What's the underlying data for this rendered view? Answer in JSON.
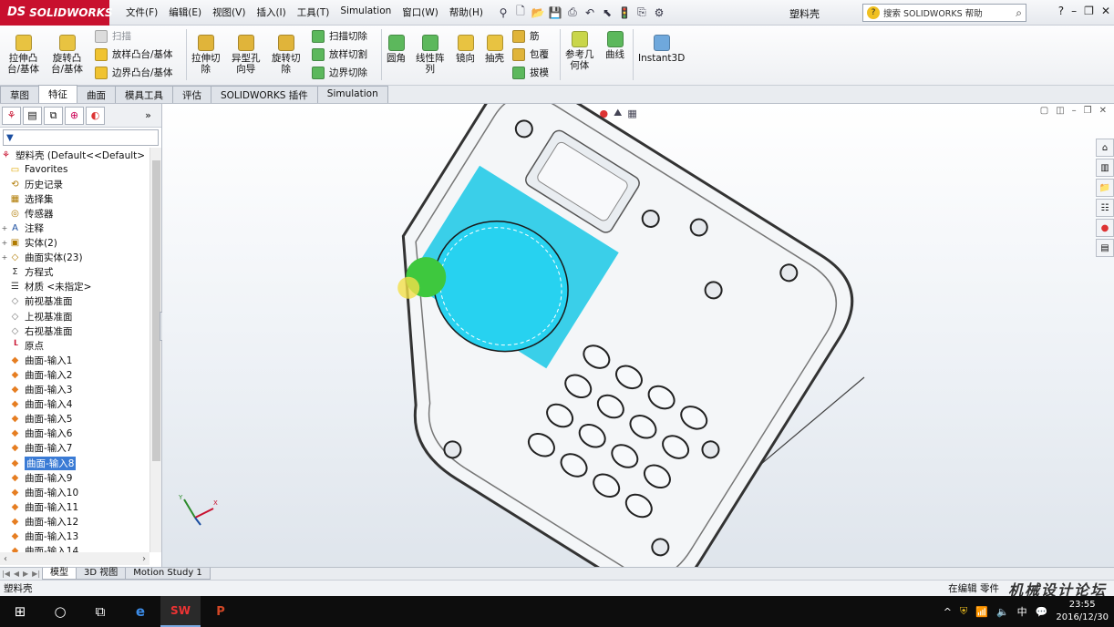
{
  "app": {
    "logo_prefix": "DS",
    "logo_text": "SOLIDWORKS",
    "doc_title": "塑料壳",
    "search_placeholder": "搜索 SOLIDWORKS 帮助"
  },
  "menu": [
    "文件(F)",
    "编辑(E)",
    "视图(V)",
    "插入(I)",
    "工具(T)",
    "Simulation",
    "窗口(W)",
    "帮助(H)"
  ],
  "ribbon": {
    "extrude_boss": "拉伸凸\n台/基体",
    "revolve_boss": "旋转凸\n台/基体",
    "sweep": "扫描",
    "loft": "放样凸台/基体",
    "boundary_boss": "边界凸台/基体",
    "extrude_cut": "拉伸切\n除",
    "hole_wizard": "异型孔\n向导",
    "revolve_cut": "旋转切\n除",
    "swept_cut": "扫描切除",
    "lofted_cut": "放样切割",
    "boundary_cut": "边界切除",
    "fillet": "圆角",
    "linear_pattern": "线性阵\n列",
    "mirror": "镜向",
    "shell": "抽壳",
    "rib": "筋",
    "wrap": "包覆",
    "draft": "拔模",
    "ref_geometry": "参考几\n何体",
    "curves": "曲线",
    "instant3d": "Instant3D"
  },
  "tabs": [
    "草图",
    "特征",
    "曲面",
    "模具工具",
    "评估",
    "SOLIDWORKS 插件",
    "Simulation"
  ],
  "active_tab": "特征",
  "tree": {
    "root": "塑料壳  (Default<<Default>",
    "items": [
      {
        "label": "Favorites",
        "icon": "folder-icon",
        "exp": ""
      },
      {
        "label": "历史记录",
        "icon": "history-icon",
        "exp": ""
      },
      {
        "label": "选择集",
        "icon": "selection-set-icon",
        "exp": ""
      },
      {
        "label": "传感器",
        "icon": "sensor-icon",
        "exp": ""
      },
      {
        "label": "注释",
        "icon": "annotation-icon",
        "exp": "+"
      },
      {
        "label": "实体(2)",
        "icon": "solid-bodies-icon",
        "exp": "+"
      },
      {
        "label": "曲面实体(23)",
        "icon": "surface-bodies-icon",
        "exp": "+"
      },
      {
        "label": "方程式",
        "icon": "equation-icon",
        "exp": ""
      },
      {
        "label": "材质 <未指定>",
        "icon": "material-icon",
        "exp": ""
      },
      {
        "label": "前视基准面",
        "icon": "plane-icon",
        "exp": ""
      },
      {
        "label": "上视基准面",
        "icon": "plane-icon",
        "exp": ""
      },
      {
        "label": "右视基准面",
        "icon": "plane-icon",
        "exp": ""
      },
      {
        "label": "原点",
        "icon": "origin-icon",
        "exp": ""
      },
      {
        "label": "曲面-输入1",
        "icon": "surface-icon",
        "exp": ""
      },
      {
        "label": "曲面-输入2",
        "icon": "surface-icon",
        "exp": ""
      },
      {
        "label": "曲面-输入3",
        "icon": "surface-icon",
        "exp": ""
      },
      {
        "label": "曲面-输入4",
        "icon": "surface-icon",
        "exp": ""
      },
      {
        "label": "曲面-输入5",
        "icon": "surface-icon",
        "exp": ""
      },
      {
        "label": "曲面-输入6",
        "icon": "surface-icon",
        "exp": ""
      },
      {
        "label": "曲面-输入7",
        "icon": "surface-icon",
        "exp": ""
      },
      {
        "label": "曲面-输入8",
        "icon": "surface-icon",
        "exp": "",
        "selected": true
      },
      {
        "label": "曲面-输入9",
        "icon": "surface-icon",
        "exp": ""
      },
      {
        "label": "曲面-输入10",
        "icon": "surface-icon",
        "exp": ""
      },
      {
        "label": "曲面-输入11",
        "icon": "surface-icon",
        "exp": ""
      },
      {
        "label": "曲面-输入12",
        "icon": "surface-icon",
        "exp": ""
      },
      {
        "label": "曲面-输入13",
        "icon": "surface-icon",
        "exp": ""
      },
      {
        "label": "曲面-输入14",
        "icon": "surface-icon",
        "exp": ""
      }
    ]
  },
  "bottom_tabs": [
    "模型",
    "3D 视图",
    "Motion Study 1"
  ],
  "status": {
    "left": "塑料壳",
    "mode": "在编辑 零件",
    "watermark": "机械设计论坛"
  },
  "clock": {
    "time": "23:55",
    "date": "2016/12/30"
  },
  "ime": "中",
  "colors": {
    "accent_red": "#c8102e",
    "surface_cyan": "#19c8e6",
    "selection_blue": "#3a7bd5"
  }
}
